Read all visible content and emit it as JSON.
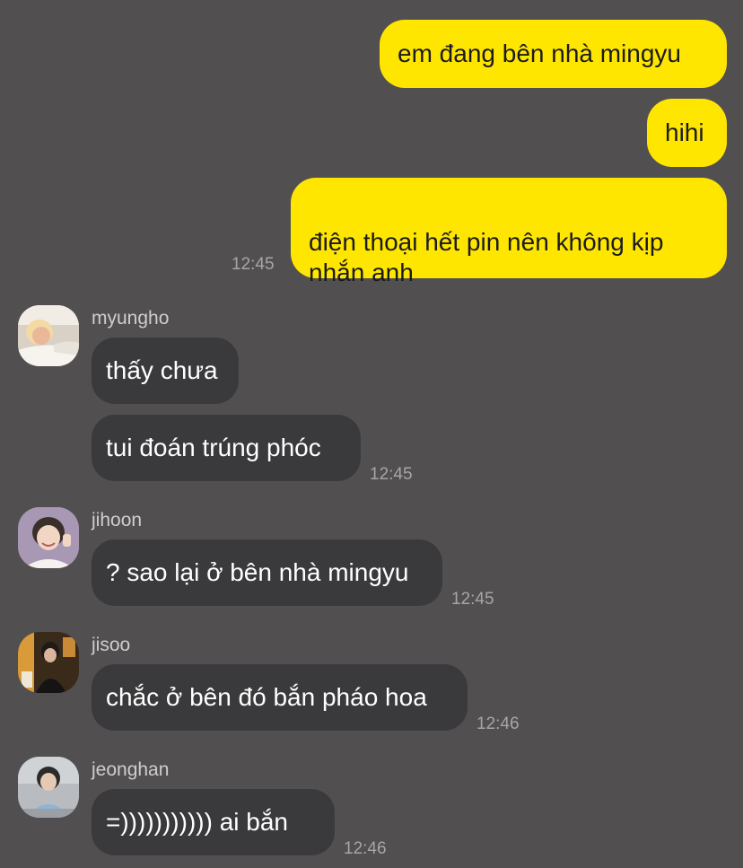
{
  "outgoing": [
    {
      "text": "em đang bên nhà mingyu"
    },
    {
      "text": "hihi"
    },
    {
      "text": "điện thoại hết pin nên không kịp\nnhắn anh",
      "time": "12:45"
    }
  ],
  "groups": [
    {
      "sender": "myungho",
      "avatar_icon": "person-sleeping-avatar",
      "messages": [
        "thấy chưa",
        "tui đoán trúng phóc"
      ],
      "time": "12:45"
    },
    {
      "sender": "jihoon",
      "avatar_icon": "person-smiling-avatar",
      "messages": [
        "? sao lại ở bên nhà mingyu"
      ],
      "time": "12:45"
    },
    {
      "sender": "jisoo",
      "avatar_icon": "person-dark-room-avatar",
      "messages": [
        "chắc ở bên đó bắn pháo hoa"
      ],
      "time": "12:46"
    },
    {
      "sender": "jeonghan",
      "avatar_icon": "person-outdoors-avatar",
      "messages": [
        "=))))))))))) ai bắn"
      ],
      "time": "12:46"
    }
  ],
  "colors": {
    "background": "#524f51",
    "outgoing_bubble": "#ffe600",
    "incoming_bubble": "#3a3a3c",
    "timestamp": "#a7a5a6"
  }
}
